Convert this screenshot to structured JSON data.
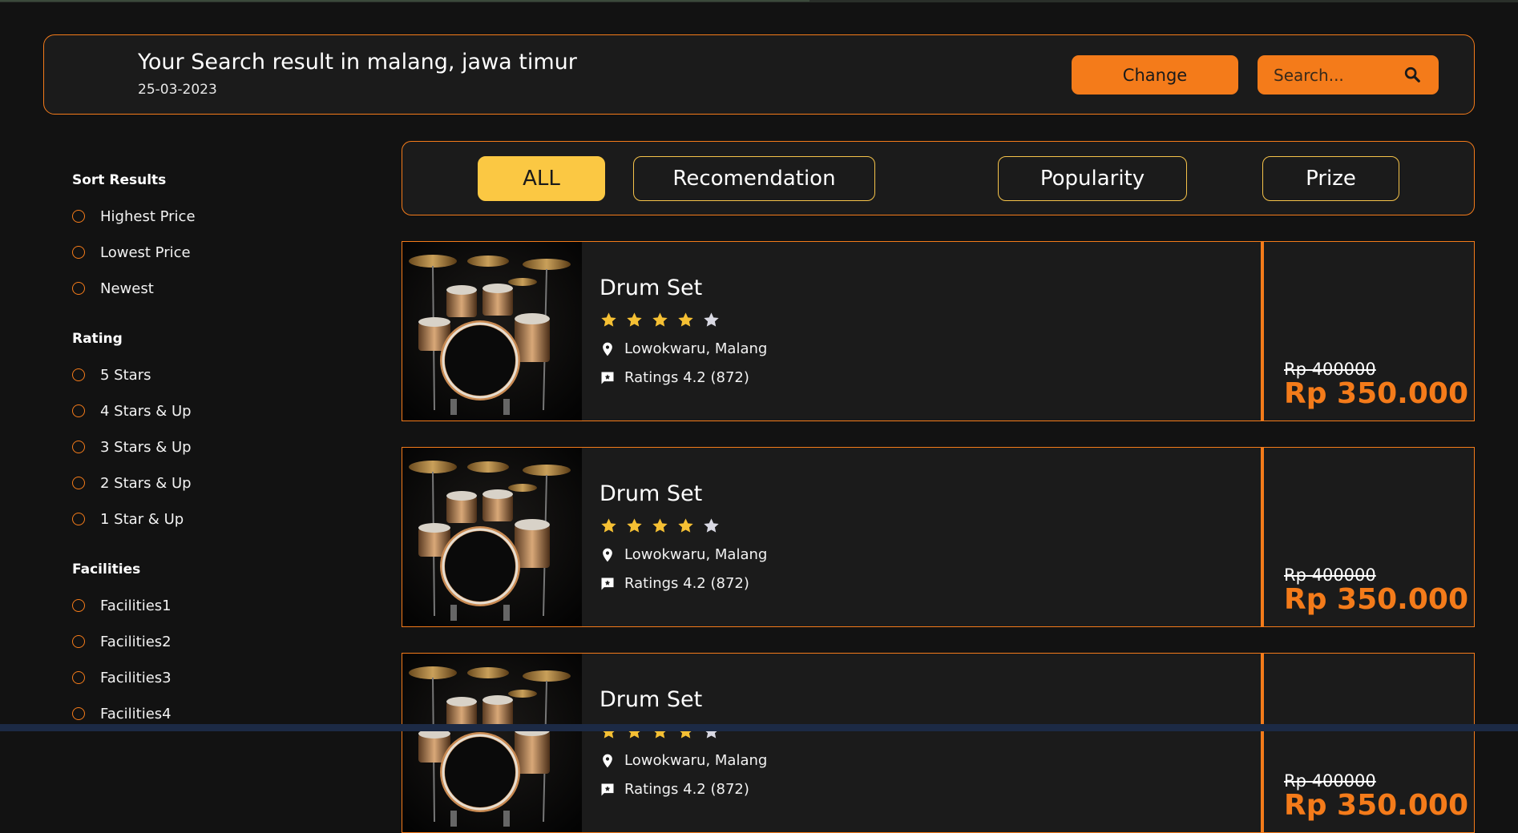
{
  "header": {
    "title": "Your Search result in malang, jawa timur",
    "date": "25-03-2023",
    "change_label": "Change",
    "search_placeholder": "Search..."
  },
  "sidebar": {
    "sort": {
      "heading": "Sort Results",
      "options": [
        "Highest Price",
        "Lowest Price",
        "Newest"
      ]
    },
    "rating": {
      "heading": "Rating",
      "options": [
        "5 Stars",
        "4 Stars & Up",
        "3 Stars & Up",
        "2 Stars & Up",
        "1 Star & Up"
      ]
    },
    "facilities": {
      "heading": "Facilities",
      "options": [
        "Facilities1",
        "Facilities2",
        "Facilities3",
        "Facilities4"
      ]
    }
  },
  "tabs": [
    {
      "label": "ALL",
      "active": true
    },
    {
      "label": "Recomendation",
      "active": false
    },
    {
      "label": "Popularity",
      "active": false
    },
    {
      "label": "Prize",
      "active": false
    }
  ],
  "colors": {
    "accent": "#f47b1a",
    "star": "#f5c034",
    "star_empty": "#d9d9e3",
    "tab_active": "#fbc843"
  },
  "results": [
    {
      "name": "Drum Set",
      "stars": 4,
      "max_stars": 5,
      "location": "Lowokwaru, Malang",
      "ratings_text": "Ratings 4.2 (872)",
      "old_price": "Rp 400000",
      "price": "Rp 350.000"
    },
    {
      "name": "Drum Set",
      "stars": 4,
      "max_stars": 5,
      "location": "Lowokwaru, Malang",
      "ratings_text": "Ratings 4.2 (872)",
      "old_price": "Rp 400000",
      "price": "Rp 350.000"
    },
    {
      "name": "Drum Set",
      "stars": 4,
      "max_stars": 5,
      "location": "Lowokwaru, Malang",
      "ratings_text": "Ratings 4.2 (872)",
      "old_price": "Rp 400000",
      "price": "Rp 350.000"
    }
  ],
  "icons": {
    "search": "search-icon",
    "location": "location-pin-icon",
    "ratings": "rating-comment-icon",
    "star": "star-icon",
    "product_image": "drum-set-image"
  }
}
